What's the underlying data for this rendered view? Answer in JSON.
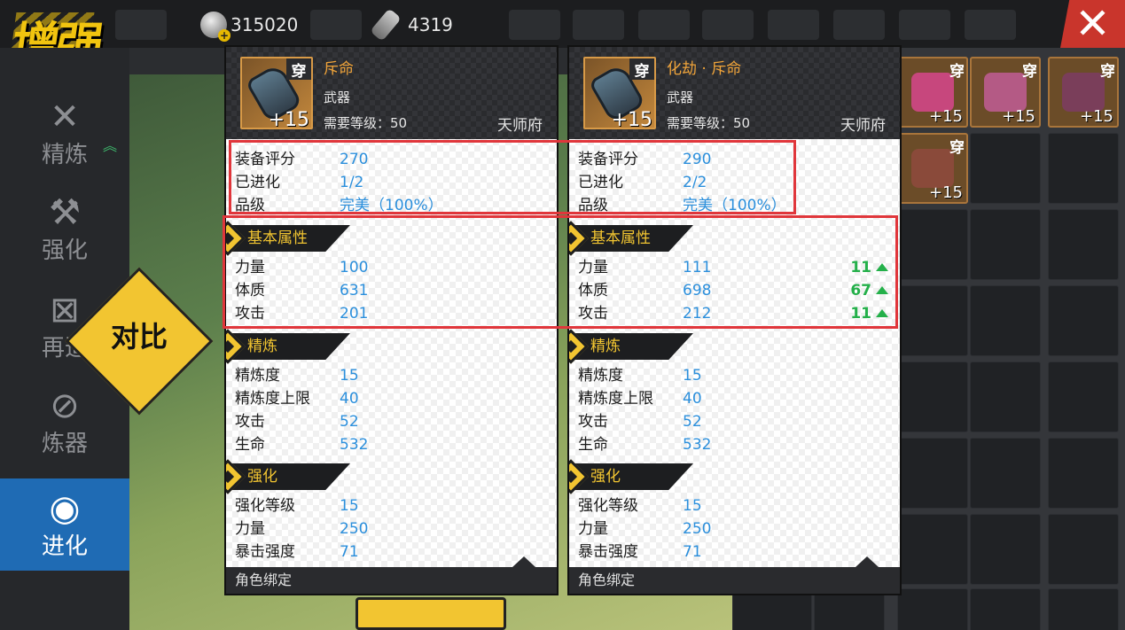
{
  "currency": {
    "coins": "315020",
    "gems": "4319"
  },
  "logo": {
    "text": "增强"
  },
  "sidebar": {
    "items": [
      {
        "label": "精炼",
        "icon": "wrench-icon"
      },
      {
        "label": "强化",
        "icon": "hammer-icon"
      },
      {
        "label": "再造",
        "icon": "reforge-icon"
      },
      {
        "label": "炼器",
        "icon": "refiner-icon"
      },
      {
        "label": "进化",
        "icon": "evolve-shirt-icon"
      }
    ]
  },
  "compare_badge": "对比",
  "left_card": {
    "wear_tag": "穿",
    "level": "+15",
    "name": "斥命",
    "type": "武器",
    "requirement": "需要等级：50",
    "faction": "天师府",
    "overview": [
      {
        "label": "装备评分",
        "value": "270"
      },
      {
        "label": "已进化",
        "value": "1/2"
      },
      {
        "label": "品级",
        "value": "完美（100%）"
      }
    ],
    "base_title": "基本属性",
    "base": [
      {
        "label": "力量",
        "value": "100"
      },
      {
        "label": "体质",
        "value": "631"
      },
      {
        "label": "攻击",
        "value": "201"
      }
    ],
    "refine_title": "精炼",
    "refine": [
      {
        "label": "精炼度",
        "value": "15"
      },
      {
        "label": "精炼度上限",
        "value": "40"
      },
      {
        "label": "攻击",
        "value": "52"
      },
      {
        "label": "生命",
        "value": "532"
      }
    ],
    "enhance_title": "强化",
    "enhance": [
      {
        "label": "强化等级",
        "value": "15"
      },
      {
        "label": "力量",
        "value": "250"
      },
      {
        "label": "暴击强度",
        "value": "71"
      }
    ],
    "footer": "角色绑定"
  },
  "right_card": {
    "wear_tag": "穿",
    "level": "+15",
    "name": "化劫 · 斥命",
    "type": "武器",
    "requirement": "需要等级：50",
    "faction": "天师府",
    "overview": [
      {
        "label": "装备评分",
        "value": "290"
      },
      {
        "label": "已进化",
        "value": "2/2"
      },
      {
        "label": "品级",
        "value": "完美（100%）"
      }
    ],
    "base_title": "基本属性",
    "base": [
      {
        "label": "力量",
        "value": "111",
        "diff": "11"
      },
      {
        "label": "体质",
        "value": "698",
        "diff": "67"
      },
      {
        "label": "攻击",
        "value": "212",
        "diff": "11"
      }
    ],
    "refine_title": "精炼",
    "refine": [
      {
        "label": "精炼度",
        "value": "15"
      },
      {
        "label": "精炼度上限",
        "value": "40"
      },
      {
        "label": "攻击",
        "value": "52"
      },
      {
        "label": "生命",
        "value": "532"
      }
    ],
    "enhance_title": "强化",
    "enhance": [
      {
        "label": "强化等级",
        "value": "15"
      },
      {
        "label": "力量",
        "value": "250"
      },
      {
        "label": "暴击强度",
        "value": "71"
      }
    ],
    "footer": "角色绑定"
  },
  "inventory": {
    "items": [
      {
        "wear_tag": "穿",
        "level": "+15",
        "icon": "glove-pink-icon"
      },
      {
        "wear_tag": "穿",
        "level": "+15",
        "icon": "jacket-icon"
      },
      {
        "wear_tag": "穿",
        "level": "+15",
        "icon": "belt-icon"
      },
      {
        "wear_tag": "穿",
        "level": "+15",
        "icon": "necklace-icon"
      }
    ]
  },
  "colors": {
    "accent_yellow": "#f2c531",
    "value_blue": "#2b8fdc",
    "increase_green": "#24b04a",
    "highlight_red": "#e0363b",
    "active_tab_blue": "#1f6bb4"
  }
}
